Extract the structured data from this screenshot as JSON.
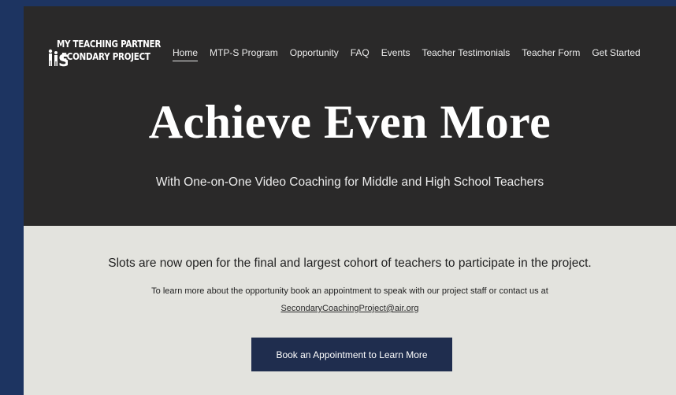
{
  "logo": {
    "line1": "MY TEACHING PARTNER",
    "line2": "ECONDARY PROJECT",
    "initial": "S"
  },
  "nav": {
    "items": [
      {
        "label": "Home",
        "active": true
      },
      {
        "label": "MTP-S Program"
      },
      {
        "label": "Opportunity"
      },
      {
        "label": "FAQ"
      },
      {
        "label": "Events"
      },
      {
        "label": "Teacher Testimonials"
      },
      {
        "label": "Teacher Form"
      },
      {
        "label": "Get Started"
      }
    ]
  },
  "hero": {
    "headline": "Achieve Even More",
    "subhead": "With One-on-One Video Coaching for Middle and High School Teachers"
  },
  "body": {
    "lead": "Slots are now open for the final and largest cohort of teachers to participate in the project.",
    "info": "To learn more about the opportunity book an appointment to speak with our project staff or contact us at",
    "email": "SecondaryCoachingProject@air.org",
    "cta": "Book an Appointment to Learn More"
  },
  "colors": {
    "page_background": "#1d3461",
    "hero_background": "#2a2929",
    "section_background": "#e3e3de",
    "button_background": "#1f2d4e"
  }
}
